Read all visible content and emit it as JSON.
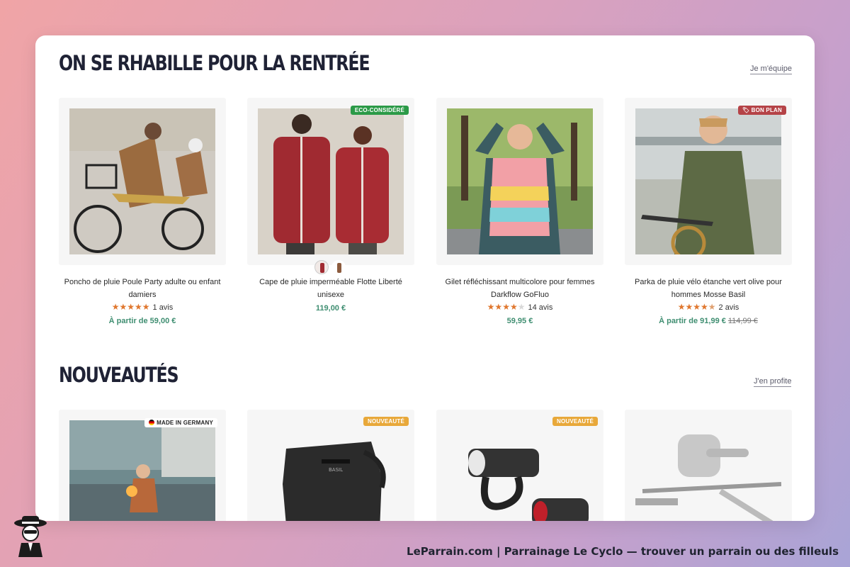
{
  "sections": [
    {
      "title": "ON SE RHABILLE POUR LA RENTRÉE",
      "link": "Je m'équipe",
      "products": [
        {
          "name": "Poncho de pluie Poule Party adulte ou enfant damiers",
          "stars": 5,
          "reviews": "1 avis",
          "price": "À partir de 59,00 €",
          "old_price": "",
          "badge": ""
        },
        {
          "name": "Cape de pluie imperméable Flotte Liberté unisexe",
          "stars": 0,
          "reviews": "",
          "price": "119,00 €",
          "old_price": "",
          "badge": "ECO-CONSIDÉRÉ"
        },
        {
          "name": "Gilet réfléchissant multicolore pour femmes Darkflow GoFluo",
          "stars": 4,
          "reviews": "14 avis",
          "price": "59,95 €",
          "old_price": "",
          "badge": ""
        },
        {
          "name": "Parka de pluie vélo étanche vert olive pour hommes Mosse Basil",
          "stars": 4.5,
          "reviews": "2 avis",
          "price": "À partir de 91,99 €",
          "old_price": "114,99 €",
          "badge": "BON PLAN"
        }
      ]
    },
    {
      "title": "NOUVEAUTÉS",
      "link": "J'en profite",
      "products": [
        {
          "badge": "MADE IN GERMANY"
        },
        {
          "badge": "NOUVEAUTÉ"
        },
        {
          "badge": "NOUVEAUTÉ"
        },
        {
          "badge": ""
        }
      ]
    }
  ],
  "footer": "LeParrain.com | Parrainage Le Cyclo — trouver un parrain ou des filleuls",
  "colors": {
    "price": "#3f8e71",
    "star": "#e0772e",
    "eco_badge": "#2b9a47",
    "deal_badge": "#b54347",
    "new_badge": "#e8a83a",
    "title": "#1f2235"
  }
}
